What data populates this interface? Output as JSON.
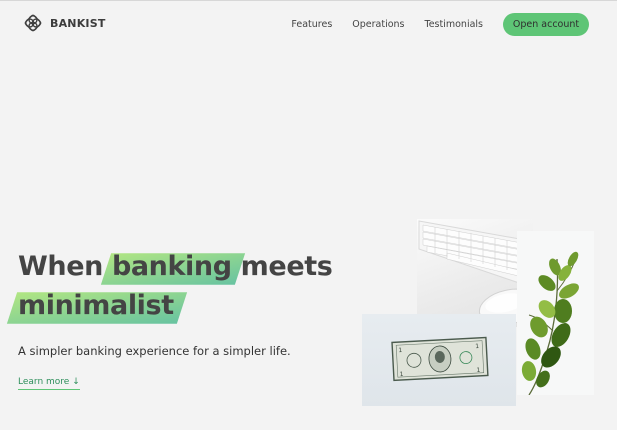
{
  "nav": {
    "logo_text": "BANKIST",
    "links": [
      {
        "label": "Features"
      },
      {
        "label": "Operations"
      },
      {
        "label": "Testimonials"
      }
    ],
    "cta_label": "Open account"
  },
  "hero": {
    "title_line1_part1": "When ",
    "title_line1_highlight": "banking",
    "title_line1_part2": " meets",
    "title_line2_highlight": "minimalist",
    "subtitle": "A simpler banking experience for a simpler life.",
    "learn_more": "Learn more ↓"
  },
  "colors": {
    "accent": "#5ec576",
    "gradient_start": "#39b385",
    "gradient_end": "#9be15d",
    "background": "#f3f3f3",
    "text": "#444444"
  },
  "icons": {
    "logo": "bankist-logo-icon"
  }
}
